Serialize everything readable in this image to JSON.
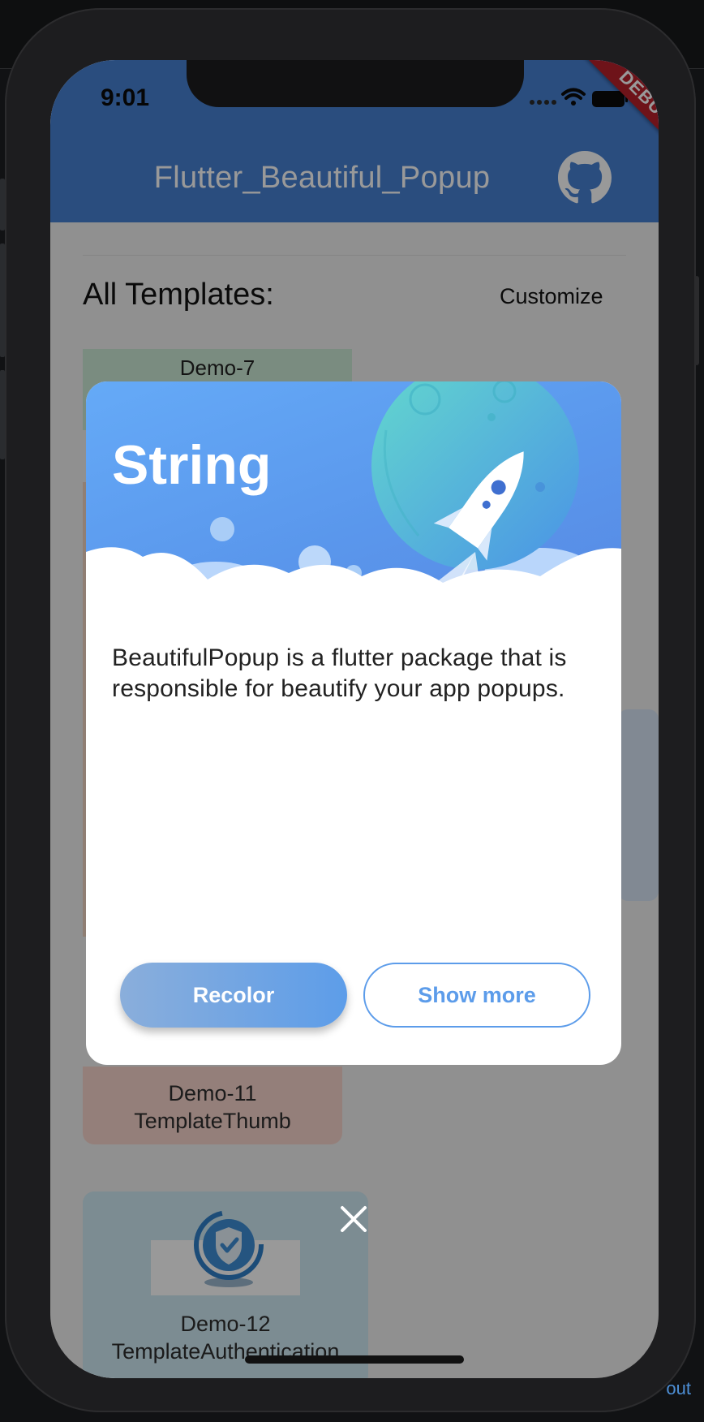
{
  "app": {
    "title": "Flutter_Beautiful_Popup",
    "debug_label": "DEBUG"
  },
  "status_bar": {
    "time": "9:01"
  },
  "page": {
    "section_title": "All Templates:",
    "customize_label": "Customize",
    "background_link": "out"
  },
  "templates": {
    "demo7": "Demo-7",
    "demo11": [
      "Demo-11",
      "TemplateThumb"
    ],
    "demo12": [
      "Demo-12",
      "TemplateAuthentication"
    ]
  },
  "popup": {
    "title": "String",
    "body": "BeautifulPopup is a flutter package that is responsible for beautify your app popups.",
    "primary_button": "Recolor",
    "secondary_button": "Show more"
  },
  "colors": {
    "appbar": "#4781d3",
    "accent": "#5c9cea",
    "debug_banner": "#b8212b"
  },
  "icons": {
    "appbar_action": "github-icon",
    "close": "close-icon",
    "status": [
      "signal-icon",
      "wifi-icon",
      "battery-icon"
    ]
  }
}
